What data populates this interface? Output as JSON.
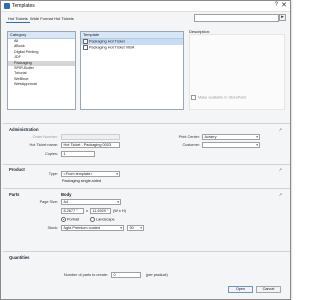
{
  "window": {
    "title": "Templates",
    "help": "?",
    "close": "✕"
  },
  "tabs": [
    "Hot Tickets",
    "Wide Format Hot Tickets"
  ],
  "search": {
    "placeholder": "",
    "button": "▸"
  },
  "category_panel": {
    "header": "Category",
    "items": [
      "All",
      "dBook",
      "Digital Printing",
      "JDF",
      "Packaging",
      "SPIR-Builer",
      "Tutorial",
      "WeBhue",
      "WebApproval"
    ]
  },
  "template_panel": {
    "header": "Template",
    "items": [
      "Packaging Hot Ticket",
      "Packaging Hot Ticket VIBA"
    ]
  },
  "description": {
    "label": "Description:",
    "publish": "Make available to StorePoint"
  },
  "administration": {
    "title": "Administration",
    "order_number_label": "Order Number:",
    "order_number": "",
    "hot_ticket_name_label": "Hot Ticket name:",
    "hot_ticket_name": "Hot Ticket - Packaging 0003",
    "copies_label": "Copies:",
    "copies": "1",
    "print_center_label": "Print Center:",
    "print_center": "Actarry",
    "customer_label": "Customer:",
    "customer": ""
  },
  "product": {
    "title": "Product",
    "type_label": "Type:",
    "type": "<From template>",
    "type_note": "Packaging single-sided"
  },
  "parts": {
    "title": "Parts",
    "body_title": "Body",
    "page_size_label": "Page Size:",
    "page_size": "A4",
    "width": "8.2677 \"",
    "times": "x",
    "height": "11.6929 \"",
    "dims_note": "(W x H)",
    "portrait": "Portrait",
    "landscape": "Landscape",
    "stock_label": "Stock:",
    "stock": "Agfa Premium coated",
    "stock_weight": "90"
  },
  "quantities": {
    "title": "Quantities",
    "parts_label": "Number of parts to create:",
    "parts_value": "0",
    "per_product": "(per product)"
  },
  "footer": {
    "open": "Open",
    "cancel": "Cancel"
  },
  "pin": "↗"
}
